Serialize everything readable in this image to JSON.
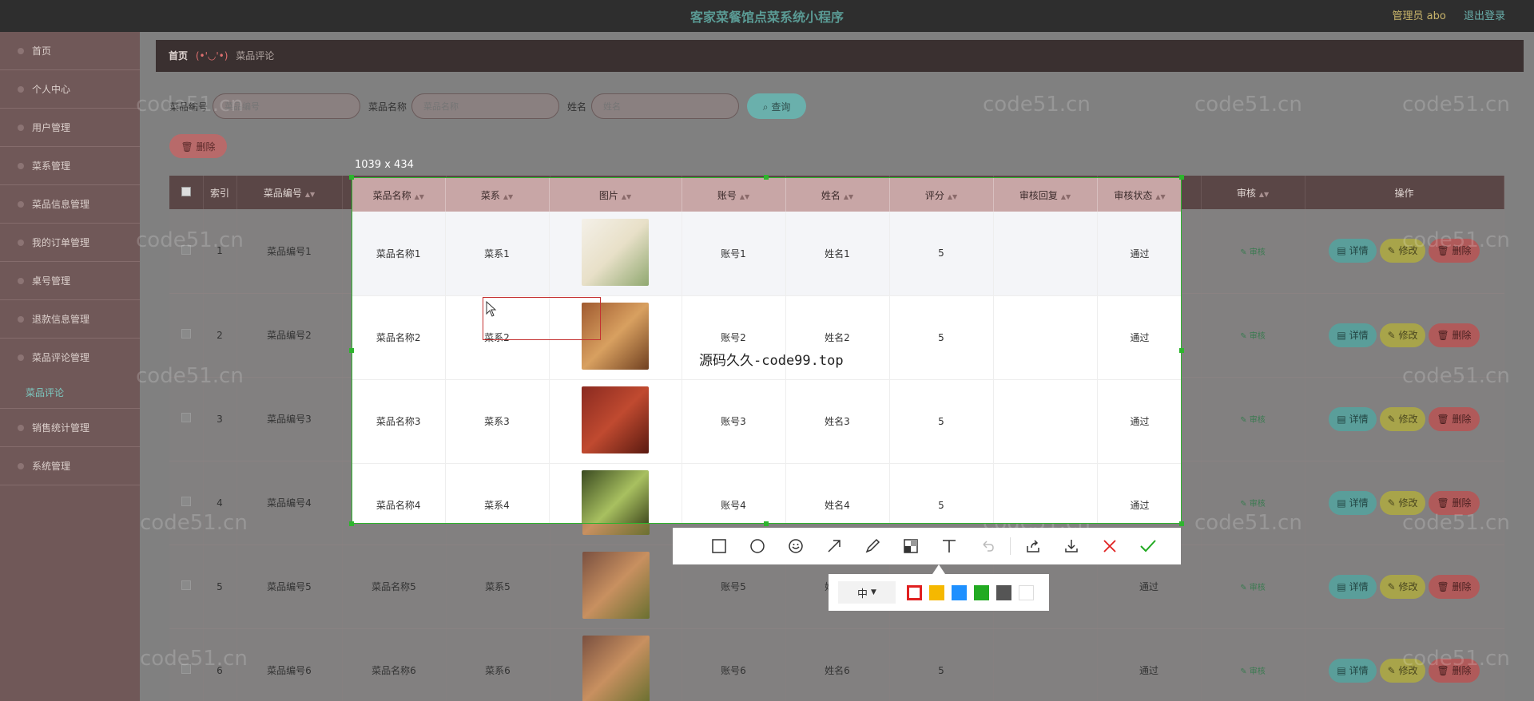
{
  "app": {
    "title": "客家菜餐馆点菜系统小程序",
    "admin_label": "管理员 abo",
    "logout_label": "退出登录"
  },
  "sidebar": {
    "items": [
      {
        "label": "首页"
      },
      {
        "label": "个人中心"
      },
      {
        "label": "用户管理"
      },
      {
        "label": "菜系管理"
      },
      {
        "label": "菜品信息管理"
      },
      {
        "label": "我的订单管理"
      },
      {
        "label": "桌号管理"
      },
      {
        "label": "退款信息管理"
      },
      {
        "label": "菜品评论管理"
      },
      {
        "label": "菜品评论"
      },
      {
        "label": "销售统计管理"
      },
      {
        "label": "系统管理"
      }
    ]
  },
  "breadcrumb": {
    "home": "首页",
    "face": "(•'◡'•)",
    "current": "菜品评论"
  },
  "search": {
    "dish_code_label": "菜品编号",
    "dish_code_placeholder": "菜品编号",
    "dish_name_label": "菜品名称",
    "dish_name_placeholder": "菜品名称",
    "name_label": "姓名",
    "name_placeholder": "姓名",
    "query_button": "查询",
    "delete_button": "删除"
  },
  "watermark": "code51.cn",
  "table": {
    "headers": [
      "索引",
      "菜品编号",
      "菜品名称",
      "菜系",
      "图片",
      "账号",
      "姓名",
      "评分",
      "审核回复",
      "审核状态",
      "审核",
      "操作"
    ],
    "audit_link": "审核",
    "ops": {
      "detail": "详情",
      "edit": "修改",
      "delete": "删除"
    },
    "rows": [
      {
        "index": "1",
        "code": "菜品编号1",
        "name": "菜品名称1",
        "cuisine": "菜系1",
        "account": "账号1",
        "person": "姓名1",
        "score": "5",
        "reply": "",
        "status": "通过"
      },
      {
        "index": "2",
        "code": "菜品编号2",
        "name": "菜品名称2",
        "cuisine": "菜系2",
        "account": "账号2",
        "person": "姓名2",
        "score": "5",
        "reply": "",
        "status": "通过"
      },
      {
        "index": "3",
        "code": "菜品编号3",
        "name": "菜品名称3",
        "cuisine": "菜系3",
        "account": "账号3",
        "person": "姓名3",
        "score": "5",
        "reply": "",
        "status": "通过"
      },
      {
        "index": "4",
        "code": "菜品编号4",
        "name": "菜品名称4",
        "cuisine": "菜系4",
        "account": "账号4",
        "person": "姓名4",
        "score": "5",
        "reply": "",
        "status": "通过"
      },
      {
        "index": "5",
        "code": "菜品编号5",
        "name": "菜品名称5",
        "cuisine": "菜系5",
        "account": "账号5",
        "person": "姓名5",
        "score": "5",
        "reply": "",
        "status": "通过"
      },
      {
        "index": "6",
        "code": "菜品编号6",
        "name": "菜品名称6",
        "cuisine": "菜系6",
        "account": "账号6",
        "person": "姓名6",
        "score": "5",
        "reply": "",
        "status": "通过"
      }
    ]
  },
  "capture": {
    "size_label": "1039 x 434",
    "overlay_text": "源码久久-code99.top"
  },
  "toolbar": {
    "tools": [
      "rectangle-icon",
      "ellipse-icon",
      "emoji-icon",
      "arrow-icon",
      "brush-icon",
      "mosaic-icon",
      "text-icon",
      "undo-icon",
      "share-icon",
      "download-icon",
      "close-icon",
      "confirm-icon"
    ],
    "size_value": "中",
    "colors": [
      "#e02020",
      "#f5b800",
      "#1e90ff",
      "#22aa22",
      "#555555",
      "#ffffff"
    ],
    "selected_color": "#e02020"
  }
}
